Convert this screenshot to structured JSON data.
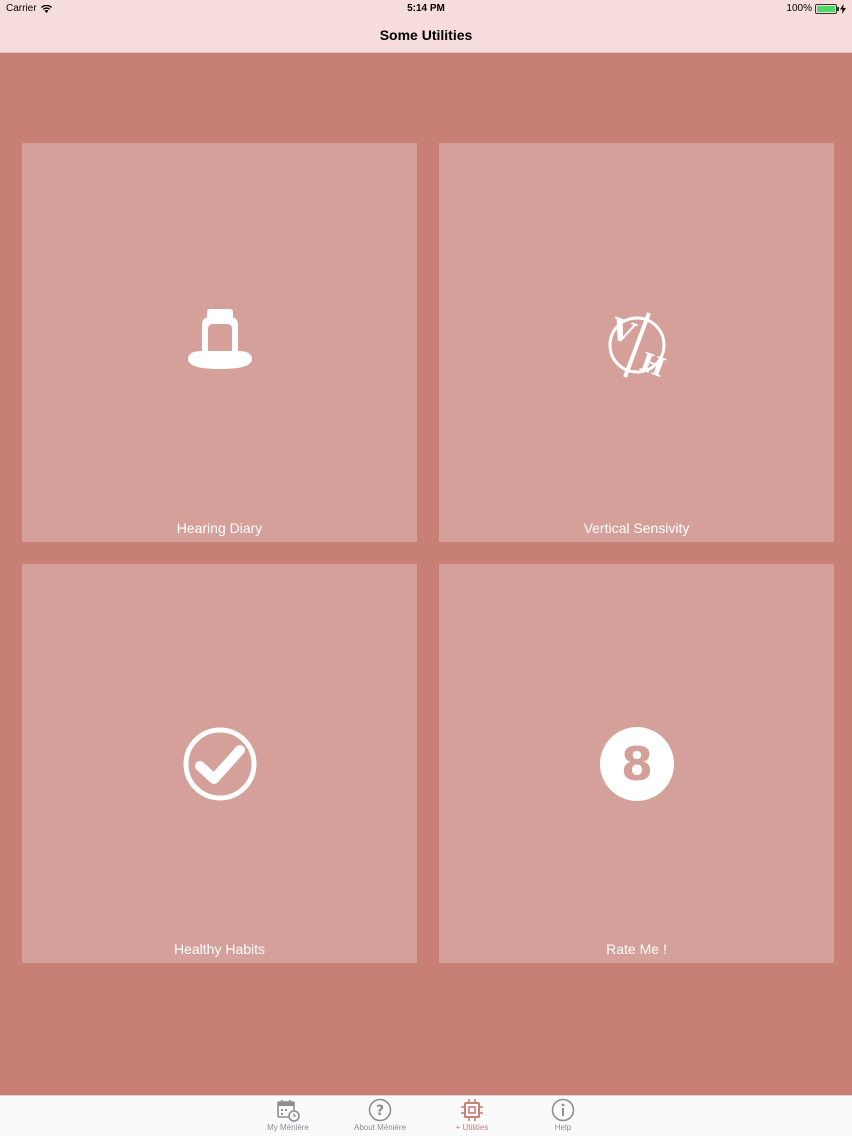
{
  "status_bar": {
    "carrier": "Carrier",
    "time": "5:14 PM",
    "battery": "100%"
  },
  "nav": {
    "title": "Some Utilities"
  },
  "tiles": [
    {
      "label": "Hearing Diary",
      "icon": "bell-jar-icon"
    },
    {
      "label": "Vertical Sensivity",
      "icon": "vh-icon"
    },
    {
      "label": "Healthy Habits",
      "icon": "check-circle-icon"
    },
    {
      "label": "Rate Me !",
      "icon": "eight-ball-icon"
    }
  ],
  "tab_bar": {
    "items": [
      {
        "label": "My Ménière",
        "icon": "calendar-clock-icon",
        "active": false
      },
      {
        "label": "About Ménière",
        "icon": "question-circle-icon",
        "active": false
      },
      {
        "label": "+ Utilities",
        "icon": "chip-icon",
        "active": true
      },
      {
        "label": "Help",
        "icon": "info-circle-icon",
        "active": false
      }
    ]
  },
  "colors": {
    "background": "#c77f76",
    "tile": "#d5a099",
    "bar": "#f6dcdb",
    "active_tab": "#c77f76"
  }
}
